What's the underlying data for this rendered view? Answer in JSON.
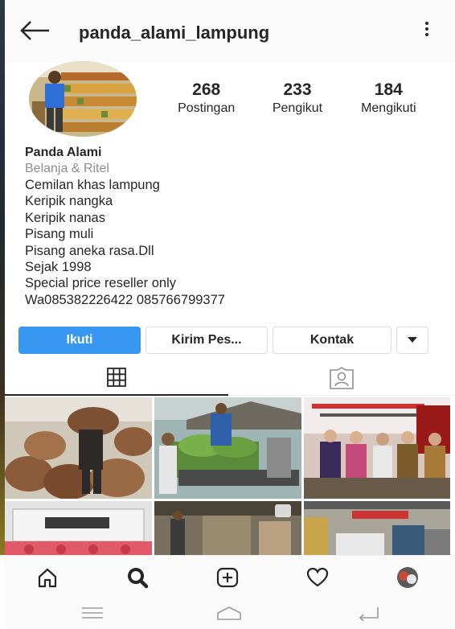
{
  "header": {
    "username": "panda_alami_lampung",
    "back_icon": "arrow-left-icon",
    "menu_icon": "kebab-menu-icon"
  },
  "profile": {
    "stats": [
      {
        "value": "268",
        "label": "Postingan"
      },
      {
        "value": "233",
        "label": "Pengikut"
      },
      {
        "value": "184",
        "label": "Mengikuti"
      }
    ],
    "name": "Panda Alami",
    "category": "Belanja & Ritel",
    "bio_lines": [
      "Cemilan khas lampung",
      "Keripik nangka",
      "Keripik nanas",
      "Pisang muli",
      "Pisang aneka rasa.Dll",
      "Sejak 1998",
      "Special price reseller only",
      "Wa085382226422 085766799377"
    ]
  },
  "actions": {
    "follow_label": "Ikuti",
    "message_label": "Kirim Pes...",
    "contact_label": "Kontak"
  },
  "colors": {
    "accent": "#3897f0",
    "text": "#262626",
    "muted": "#8e8e8e"
  }
}
